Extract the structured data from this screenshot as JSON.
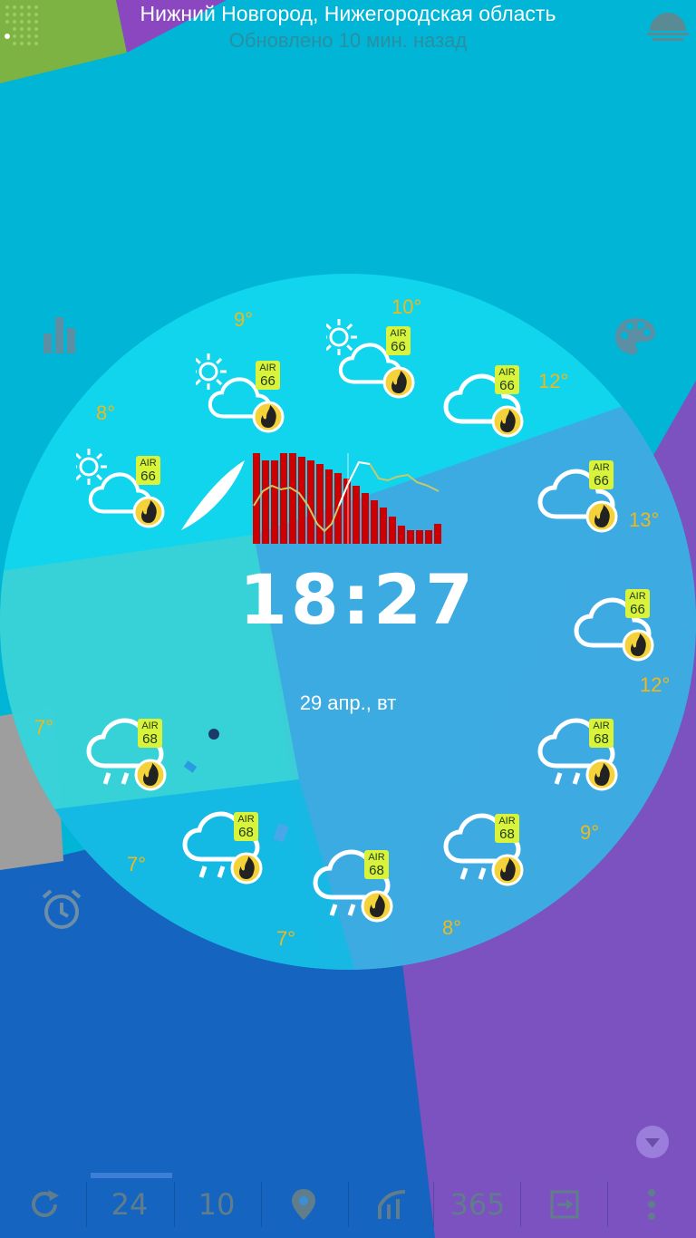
{
  "header": {
    "city": "Нижний Новгород, Нижегородская область",
    "updated": "Обновлено 10 мин. назад"
  },
  "icons": {
    "menu_dots": "dots-grid-icon",
    "sunset": "sunset-icon",
    "stats": "bar-chart-icon",
    "palette": "palette-icon",
    "alarm": "alarm-icon",
    "expand": "chevron-down-icon"
  },
  "clock": {
    "time": "18:27",
    "date": "29 апр., вт"
  },
  "hourly": [
    {
      "temp": "9°",
      "icon": "partly-cloudy",
      "air": "66"
    },
    {
      "temp": "10°",
      "icon": "partly-cloudy",
      "air": "66"
    },
    {
      "temp": "12°",
      "icon": "cloudy",
      "air": "66"
    },
    {
      "temp": "13°",
      "icon": "cloudy",
      "air": "66"
    },
    {
      "temp": "12°",
      "icon": "cloudy",
      "air": "66"
    },
    {
      "temp": "9°",
      "icon": "rain",
      "air": "68"
    },
    {
      "temp": "8°",
      "icon": "rain",
      "air": "68"
    },
    {
      "temp": "7°",
      "icon": "rain",
      "air": "68"
    },
    {
      "temp": "7°",
      "icon": "rain",
      "air": "68"
    },
    {
      "temp": "7°",
      "icon": "rain",
      "air": "68"
    },
    {
      "temp": "8°",
      "icon": "partly-cloudy",
      "air": "66"
    }
  ],
  "air_label": "AIR",
  "bottom_bar": {
    "refresh": "refresh-icon",
    "hours24": "24",
    "days10": "10",
    "location": "location-pin-icon",
    "graph": "graph-icon",
    "days365": "365",
    "exit": "exit-icon",
    "more": "more-vertical-icon"
  },
  "colors": {
    "cyan": "#00b5d6",
    "purple": "#7b52c0",
    "blue": "#1565c0",
    "green": "#7cb342",
    "dial": "#12d8ee",
    "temp": "#f2b718",
    "air_badge": "#d9f23a",
    "bar": "#cc0000"
  },
  "chart_data": {
    "type": "bar",
    "values": [
      100,
      92,
      92,
      100,
      100,
      96,
      92,
      88,
      82,
      78,
      72,
      64,
      56,
      48,
      40,
      30,
      20,
      15,
      15,
      15,
      22
    ]
  }
}
